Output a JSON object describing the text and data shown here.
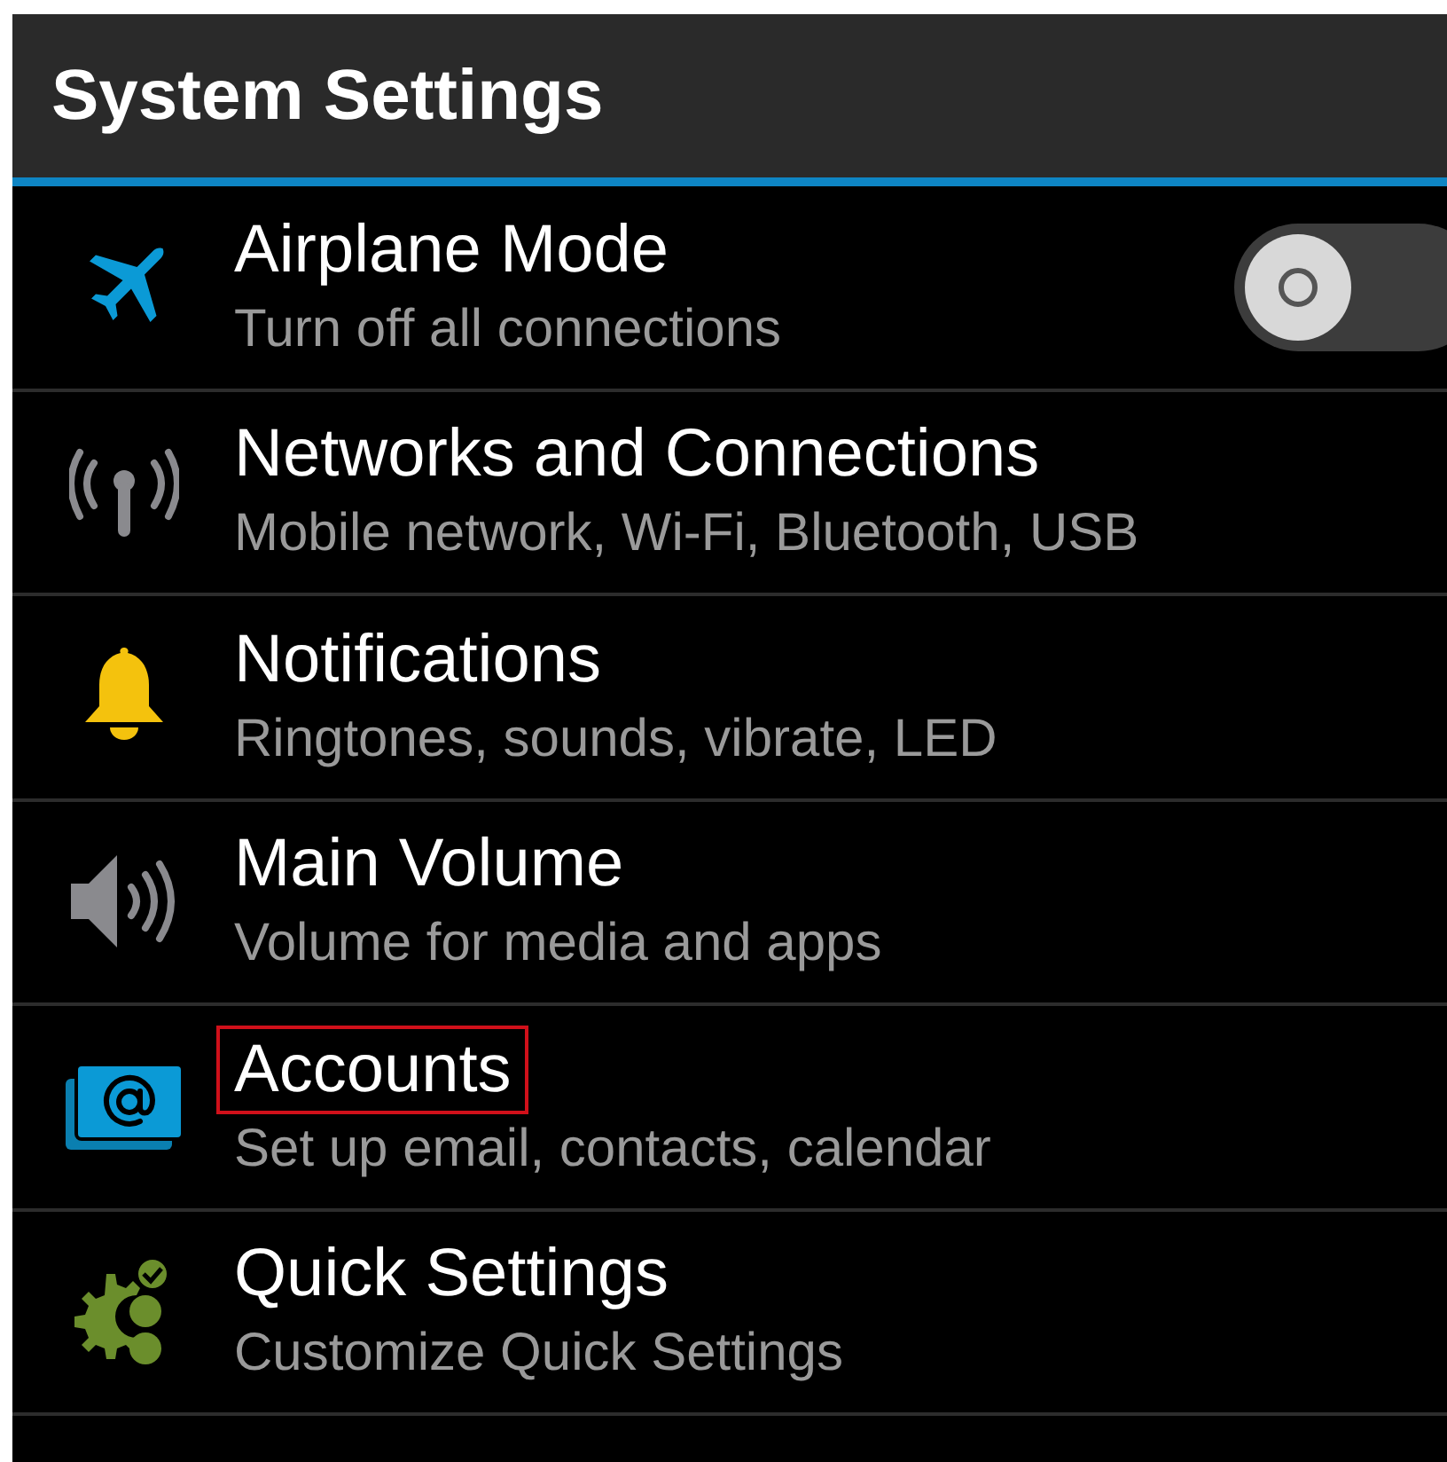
{
  "header": {
    "title": "System Settings"
  },
  "items": [
    {
      "title": "Airplane Mode",
      "subtitle": "Turn off all connections",
      "toggle": {
        "on": false
      },
      "highlighted": false
    },
    {
      "title": "Networks and Connections",
      "subtitle": "Mobile network, Wi-Fi, Bluetooth, USB",
      "highlighted": false
    },
    {
      "title": "Notifications",
      "subtitle": "Ringtones, sounds, vibrate, LED",
      "highlighted": false
    },
    {
      "title": "Main Volume",
      "subtitle": "Volume for media and apps",
      "highlighted": false
    },
    {
      "title": "Accounts",
      "subtitle": "Set up email, contacts, calendar",
      "highlighted": true
    },
    {
      "title": "Quick Settings",
      "subtitle": "Customize Quick Settings",
      "highlighted": false
    }
  ]
}
